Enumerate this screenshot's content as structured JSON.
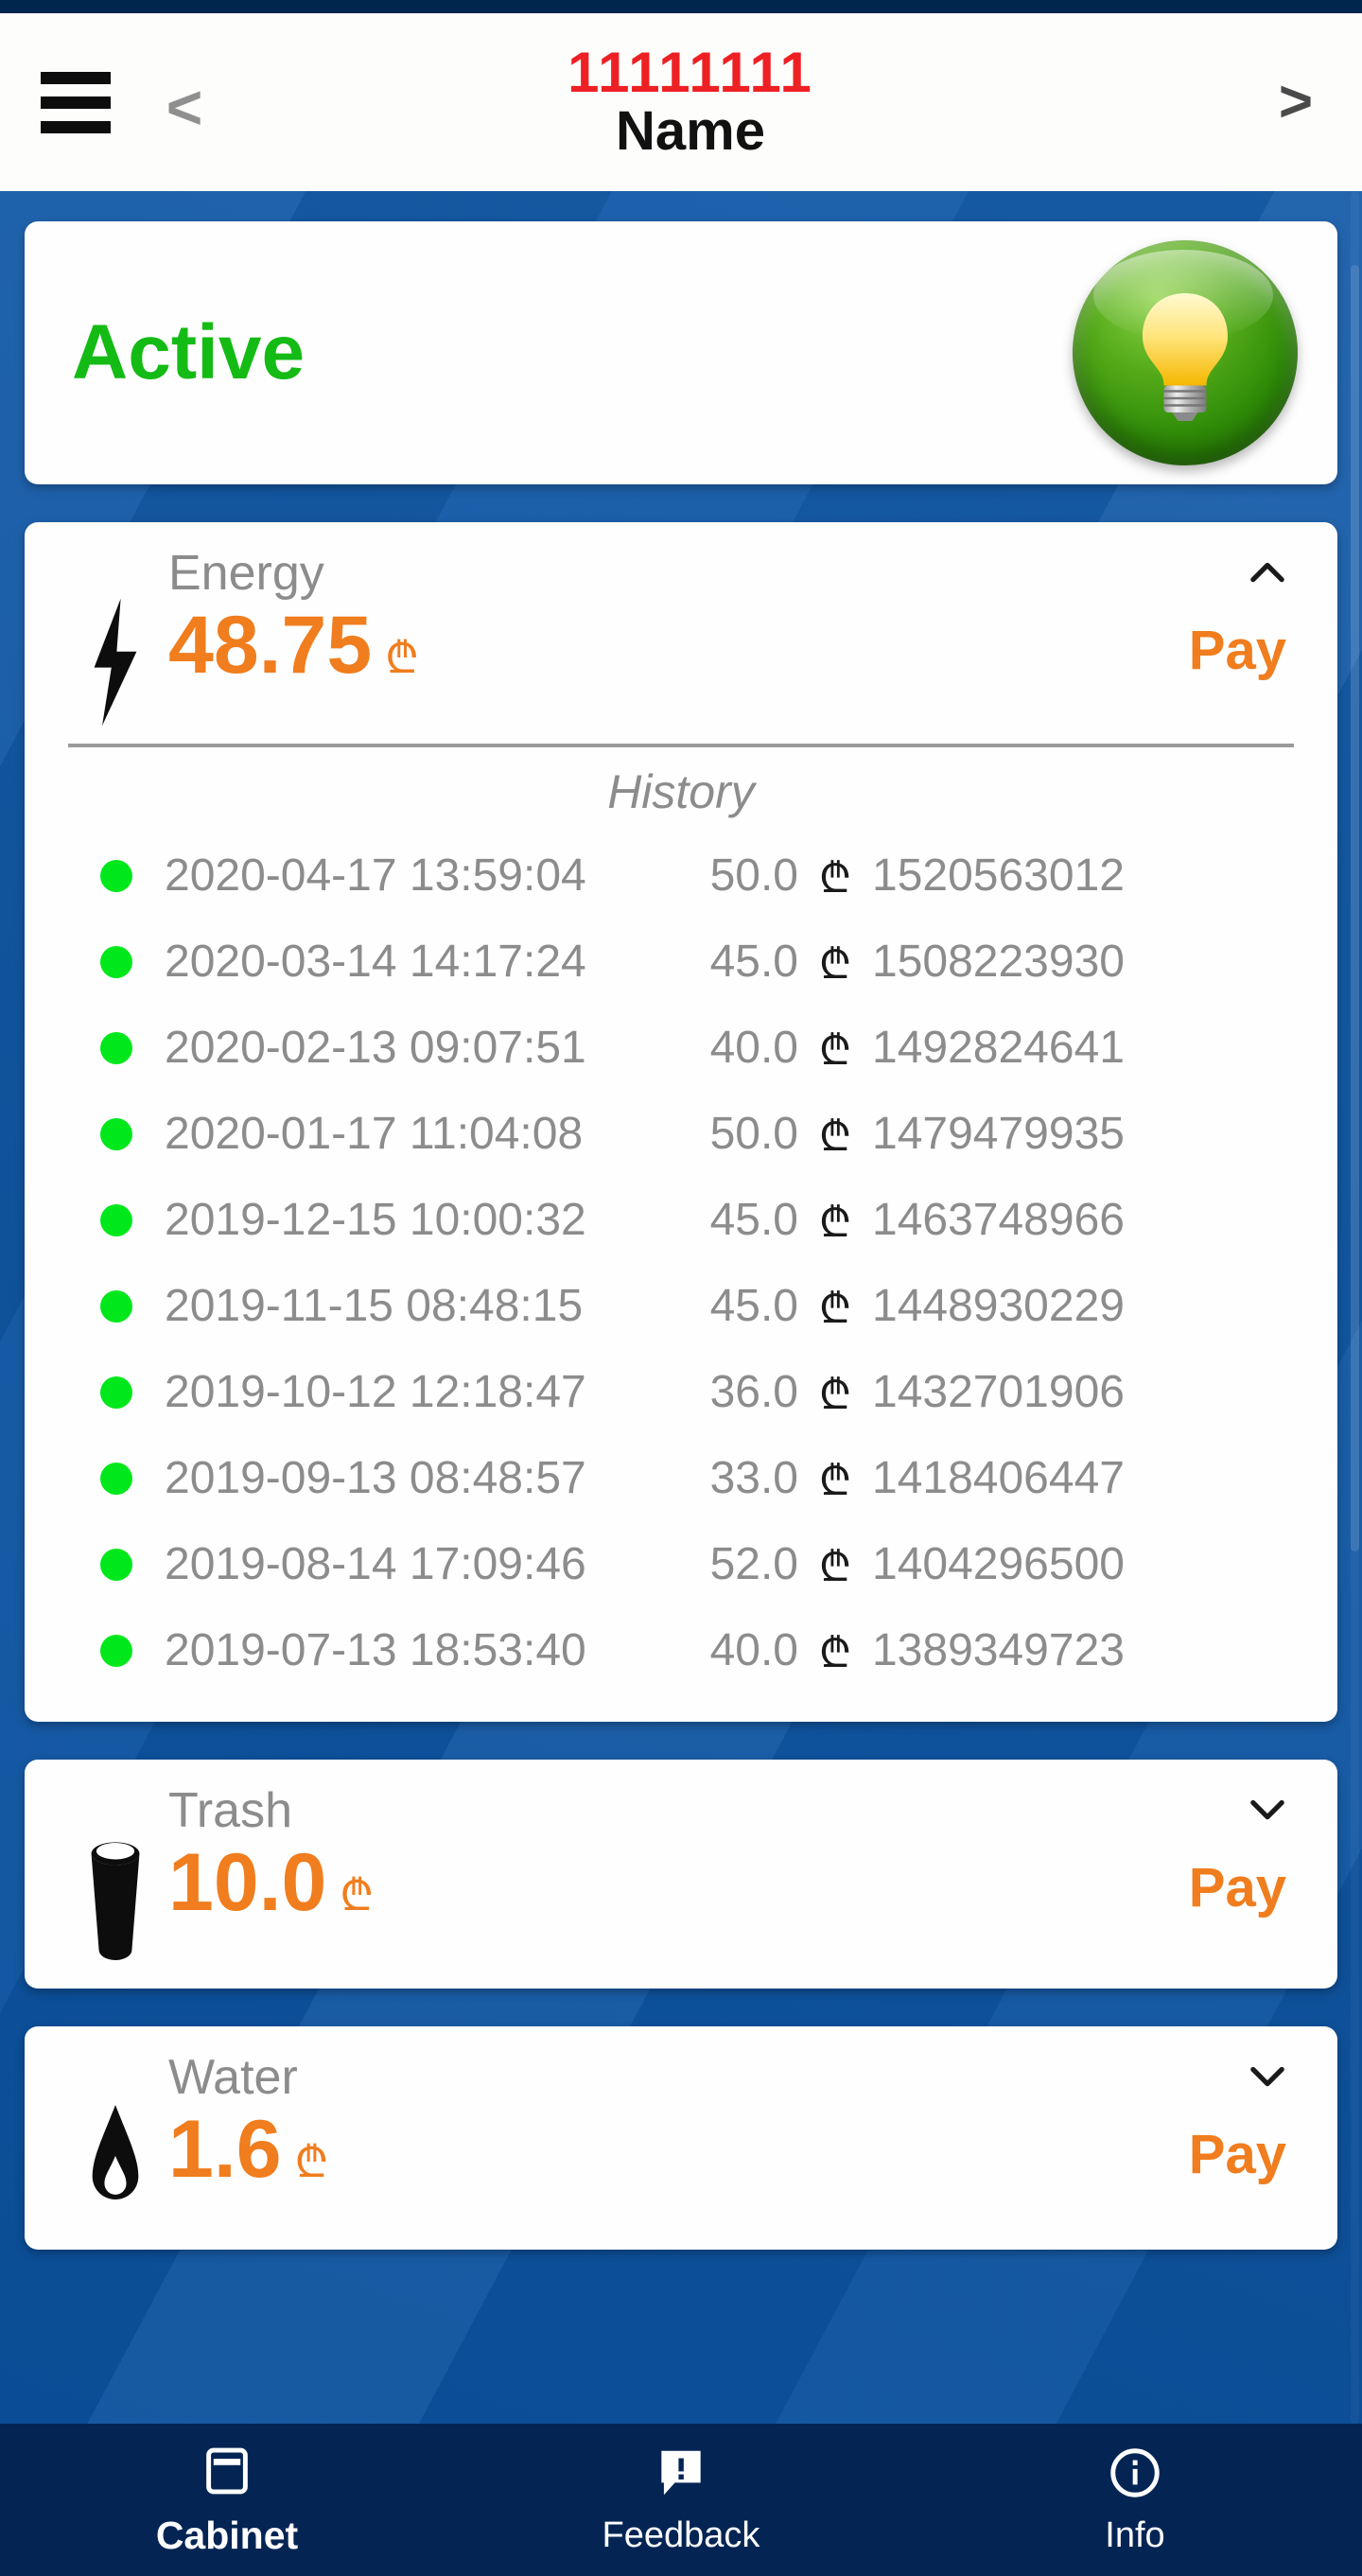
{
  "colors": {
    "background_blue": "#0b55a6",
    "status_bar": "#00264d",
    "accent_orange": "#f07d1e",
    "active_green": "#14bb14",
    "account_red": "#ed2024",
    "nav_bar": "#042554",
    "label_gray": "#8c8c8c",
    "history_dot_green": "#00e81c"
  },
  "header": {
    "menu_icon": "hamburger-menu-icon",
    "back_label": "<",
    "account_number": "11111111",
    "account_name": "Name",
    "forward_label": ">"
  },
  "status_card": {
    "label": "Active",
    "toggle_icon": "lightbulb-icon"
  },
  "currency_symbol": "₾",
  "utilities": [
    {
      "id": "energy",
      "icon": "lightning-bolt-icon",
      "label": "Energy",
      "amount": "48.75",
      "currency": "₾",
      "pay_label": "Pay",
      "expanded": true,
      "chevron": "chevron-up-icon",
      "history_title": "History",
      "history": [
        {
          "status": "paid",
          "datetime": "2020-04-17 13:59:04",
          "amount": "50.0",
          "currency": "₾",
          "transaction_id": "1520563012"
        },
        {
          "status": "paid",
          "datetime": "2020-03-14 14:17:24",
          "amount": "45.0",
          "currency": "₾",
          "transaction_id": "1508223930"
        },
        {
          "status": "paid",
          "datetime": "2020-02-13 09:07:51",
          "amount": "40.0",
          "currency": "₾",
          "transaction_id": "1492824641"
        },
        {
          "status": "paid",
          "datetime": "2020-01-17 11:04:08",
          "amount": "50.0",
          "currency": "₾",
          "transaction_id": "1479479935"
        },
        {
          "status": "paid",
          "datetime": "2019-12-15 10:00:32",
          "amount": "45.0",
          "currency": "₾",
          "transaction_id": "1463748966"
        },
        {
          "status": "paid",
          "datetime": "2019-11-15 08:48:15",
          "amount": "45.0",
          "currency": "₾",
          "transaction_id": "1448930229"
        },
        {
          "status": "paid",
          "datetime": "2019-10-12 12:18:47",
          "amount": "36.0",
          "currency": "₾",
          "transaction_id": "1432701906"
        },
        {
          "status": "paid",
          "datetime": "2019-09-13 08:48:57",
          "amount": "33.0",
          "currency": "₾",
          "transaction_id": "1418406447"
        },
        {
          "status": "paid",
          "datetime": "2019-08-14 17:09:46",
          "amount": "52.0",
          "currency": "₾",
          "transaction_id": "1404296500"
        },
        {
          "status": "paid",
          "datetime": "2019-07-13 18:53:40",
          "amount": "40.0",
          "currency": "₾",
          "transaction_id": "1389349723"
        }
      ]
    },
    {
      "id": "trash",
      "icon": "trash-bin-icon",
      "label": "Trash",
      "amount": "10.0",
      "currency": "₾",
      "pay_label": "Pay",
      "expanded": false,
      "chevron": "chevron-down-icon"
    },
    {
      "id": "water",
      "icon": "water-drop-icon",
      "label": "Water",
      "amount": "1.6",
      "currency": "₾",
      "pay_label": "Pay",
      "expanded": false,
      "chevron": "chevron-down-icon"
    }
  ],
  "bottom_nav": {
    "items": [
      {
        "id": "cabinet",
        "label": "Cabinet",
        "icon": "wallet-card-icon",
        "active": true
      },
      {
        "id": "feedback",
        "label": "Feedback",
        "icon": "speech-bubble-alert-icon",
        "active": false
      },
      {
        "id": "info",
        "label": "Info",
        "icon": "info-circle-icon",
        "active": false
      }
    ]
  }
}
